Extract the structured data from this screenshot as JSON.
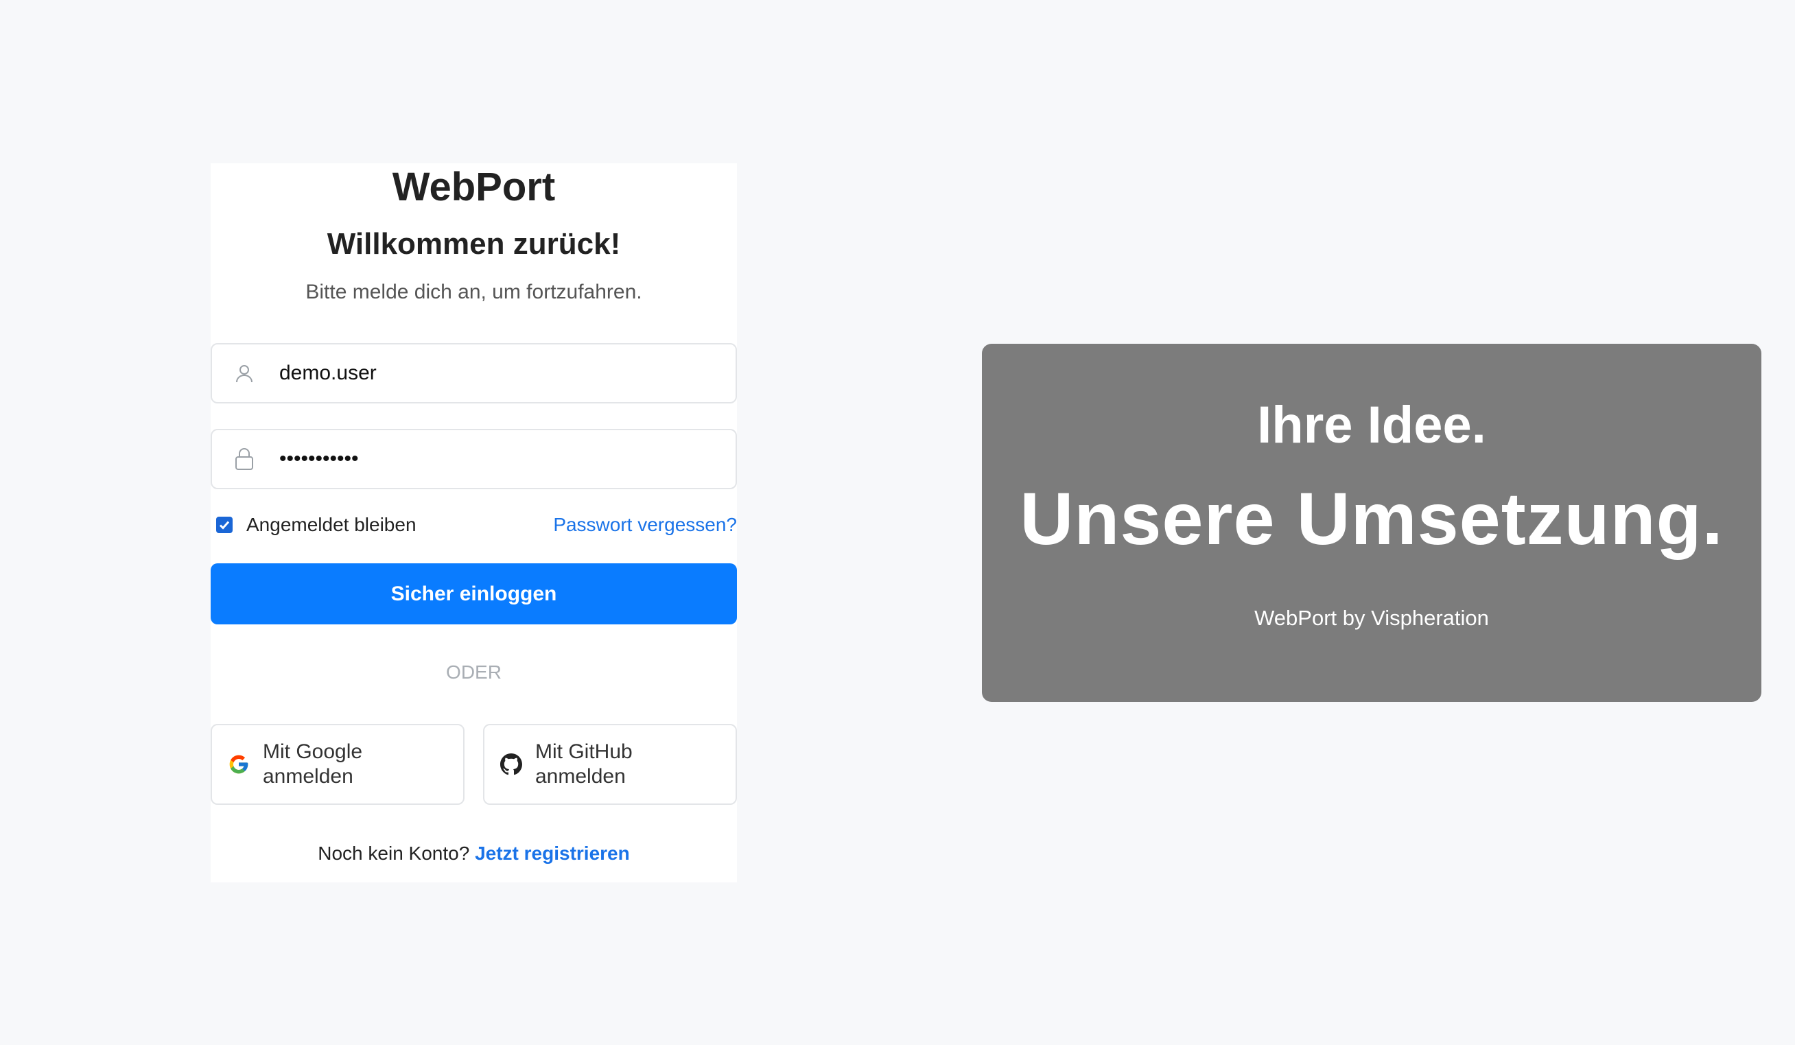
{
  "login": {
    "brand": "WebPort",
    "welcome": "Willkommen zurück!",
    "subtitle": "Bitte melde dich an, um fortzufahren.",
    "username": {
      "value": "demo.user",
      "icon": "user-icon"
    },
    "password": {
      "value": "•••••••••••",
      "icon": "lock-icon"
    },
    "remember_label": "Angemeldet bleiben",
    "remember_checked": true,
    "forgot_link": "Passwort vergessen?",
    "submit_label": "Sicher einloggen",
    "divider": "ODER",
    "google_label": "Mit Google anmelden",
    "github_label": "Mit GitHub anmelden",
    "register_prompt": "Noch kein Konto?",
    "register_link": "Jetzt registrieren"
  },
  "hero": {
    "line1": "Ihre Idee.",
    "line2": "Unsere Umsetzung.",
    "caption": "WebPort by Vispheration"
  },
  "colors": {
    "accent": "#0a7cff",
    "link": "#1a73e8",
    "hero_bg": "#7c7c7c",
    "page_bg": "#f7f8fa"
  }
}
